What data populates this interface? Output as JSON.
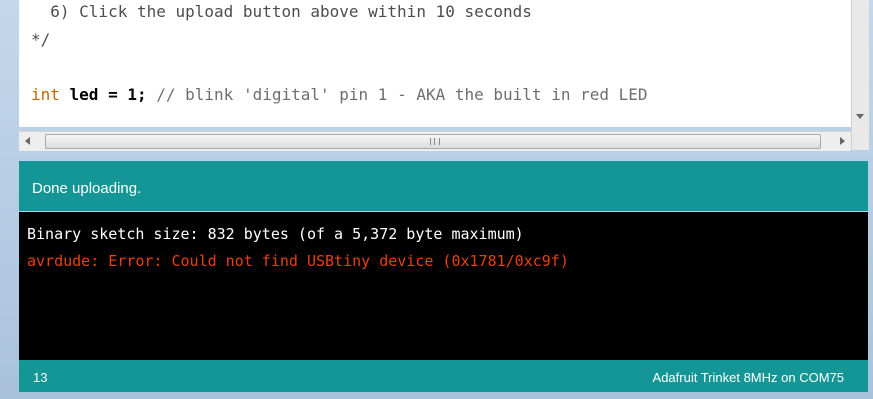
{
  "editor": {
    "line_upload": "  6) Click the upload button above within 10 seconds",
    "line_comment_end": "*/",
    "line_int_type": "int",
    "line_int_decl": " led = 1;",
    "line_int_comment": " // blink 'digital' pin 1 - AKA the built in red LED"
  },
  "status": {
    "message": "Done uploading."
  },
  "console": {
    "line1": "Binary sketch size: 832 bytes (of a 5,372 byte maximum)",
    "line2": "avrdude: Error: Could not find USBtiny device (0x1781/0xc9f)"
  },
  "footer": {
    "line_number": "13",
    "board": "Adafruit Trinket 8MHz on COM75"
  },
  "colors": {
    "teal": "#149696",
    "error_text": "#e8410d",
    "keyword": "#cc6600"
  }
}
